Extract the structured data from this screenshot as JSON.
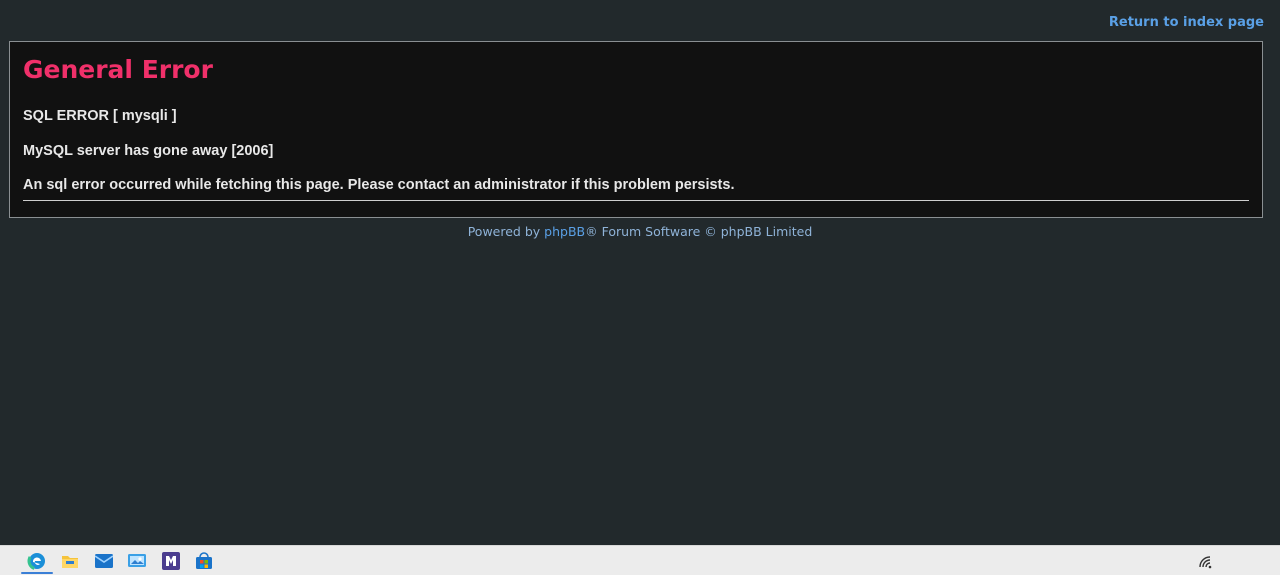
{
  "header": {
    "return_link": "Return to index page"
  },
  "error": {
    "title": "General Error",
    "messages": [
      "SQL ERROR [ mysqli ]",
      "MySQL server has gone away [2006]",
      "An sql error occurred while fetching this page. Please contact an administrator if this problem persists."
    ]
  },
  "footer": {
    "prefix": "Powered by ",
    "brand_link": "phpBB",
    "suffix": "® Forum Software © phpBB Limited"
  },
  "taskbar": {
    "icons": [
      "edge-icon",
      "file-explorer-icon",
      "mail-icon",
      "photos-icon",
      "teams-icon",
      "store-icon"
    ],
    "tray": [
      "network-icon"
    ]
  },
  "colors": {
    "background": "#22292c",
    "panel": "#111111",
    "title": "#f0306a",
    "link": "#5aa0e6"
  }
}
